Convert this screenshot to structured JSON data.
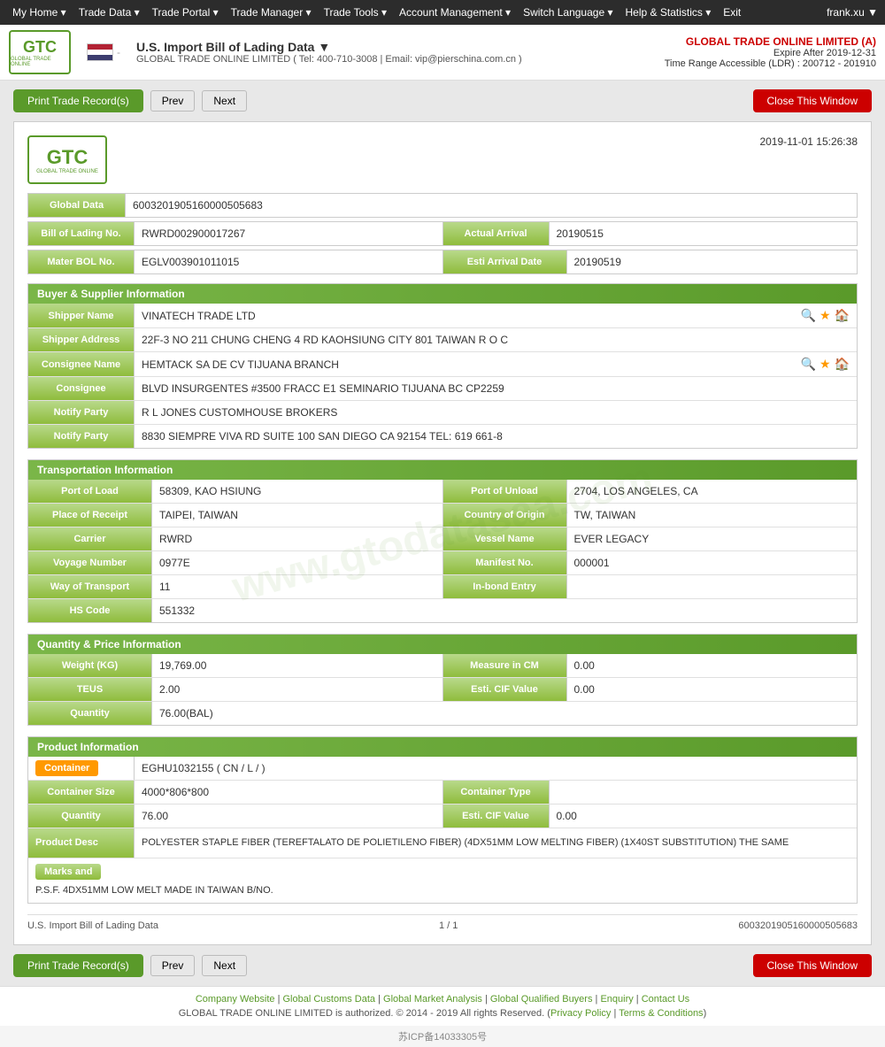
{
  "nav": {
    "items": [
      {
        "label": "My Home",
        "hasDropdown": true
      },
      {
        "label": "Trade Data",
        "hasDropdown": true
      },
      {
        "label": "Trade Portal",
        "hasDropdown": true
      },
      {
        "label": "Trade Manager",
        "hasDropdown": true
      },
      {
        "label": "Trade Tools",
        "hasDropdown": true
      },
      {
        "label": "Account Management",
        "hasDropdown": true
      },
      {
        "label": "Switch Language",
        "hasDropdown": true
      },
      {
        "label": "Help & Statistics",
        "hasDropdown": true
      },
      {
        "label": "Exit",
        "hasDropdown": false
      }
    ],
    "user": "frank.xu ▼"
  },
  "header": {
    "site_title": "U.S. Import Bill of Lading Data ▼",
    "contact": "GLOBAL TRADE ONLINE LIMITED ( Tel: 400-710-3008 | Email: vip@pierschina.com.cn )",
    "company": "GLOBAL TRADE ONLINE LIMITED (A)",
    "expire": "Expire After 2019-12-31",
    "time_range": "Time Range Accessible (LDR) : 200712 - 201910"
  },
  "toolbar": {
    "print_label": "Print Trade Record(s)",
    "prev_label": "Prev",
    "next_label": "Next",
    "close_label": "Close This Window"
  },
  "document": {
    "datetime": "2019-11-01 15:26:38",
    "global_data_label": "Global Data",
    "global_data_value": "6003201905160000505683",
    "bol_label": "Bill of Lading No.",
    "bol_value": "RWRD002900017267",
    "actual_arrival_label": "Actual Arrival",
    "actual_arrival_value": "20190515",
    "mater_bol_label": "Mater BOL No.",
    "mater_bol_value": "EGLV003901011015",
    "esti_arrival_label": "Esti Arrival Date",
    "esti_arrival_value": "20190519",
    "buyer_section": "Buyer & Supplier Information",
    "shipper_name_label": "Shipper Name",
    "shipper_name_value": "VINATECH TRADE LTD",
    "shipper_addr_label": "Shipper Address",
    "shipper_addr_value": "22F-3 NO 211 CHUNG CHENG 4 RD KAOHSIUNG CITY 801 TAIWAN R O C",
    "consignee_name_label": "Consignee Name",
    "consignee_name_value": "HEMTACK SA DE CV TIJUANA BRANCH",
    "consignee_label": "Consignee",
    "consignee_value": "BLVD INSURGENTES #3500 FRACC E1 SEMINARIO TIJUANA BC CP2259",
    "notify1_label": "Notify Party",
    "notify1_value": "R L JONES CUSTOMHOUSE BROKERS",
    "notify2_label": "Notify Party",
    "notify2_value": "8830 SIEMPRE VIVA RD SUITE 100 SAN DIEGO CA 92154 TEL: 619 661-8",
    "transport_section": "Transportation Information",
    "port_load_label": "Port of Load",
    "port_load_value": "58309, KAO HSIUNG",
    "port_unload_label": "Port of Unload",
    "port_unload_value": "2704, LOS ANGELES, CA",
    "place_receipt_label": "Place of Receipt",
    "place_receipt_value": "TAIPEI, TAIWAN",
    "country_origin_label": "Country of Origin",
    "country_origin_value": "TW, TAIWAN",
    "carrier_label": "Carrier",
    "carrier_value": "RWRD",
    "vessel_label": "Vessel Name",
    "vessel_value": "EVER LEGACY",
    "voyage_label": "Voyage Number",
    "voyage_value": "0977E",
    "manifest_label": "Manifest No.",
    "manifest_value": "000001",
    "transport_label": "Way of Transport",
    "transport_value": "11",
    "inbond_label": "In-bond Entry",
    "inbond_value": "",
    "hscode_label": "HS Code",
    "hscode_value": "551332",
    "qty_section": "Quantity & Price Information",
    "weight_label": "Weight (KG)",
    "weight_value": "19,769.00",
    "measure_label": "Measure in CM",
    "measure_value": "0.00",
    "teus_label": "TEUS",
    "teus_value": "2.00",
    "esti_cif_label": "Esti. CIF Value",
    "esti_cif_value": "0.00",
    "qty_label": "Quantity",
    "qty_value": "76.00(BAL)",
    "product_section": "Product Information",
    "container_label": "Container",
    "container_value": "EGHU1032155 ( CN / L / )",
    "container_size_label": "Container Size",
    "container_size_value": "4000*806*800",
    "container_type_label": "Container Type",
    "container_type_value": "",
    "qty2_label": "Quantity",
    "qty2_value": "76.00",
    "esti_cif2_label": "Esti. CIF Value",
    "esti_cif2_value": "0.00",
    "product_desc_label": "Product Desc",
    "product_desc_value": "POLYESTER STAPLE FIBER (TEREFTALATO DE POLIETILENO FIBER) (4DX51MM LOW MELTING FIBER) (1X40ST SUBSTITUTION) THE SAME",
    "marks_label": "Marks and",
    "marks_value": "P.S.F. 4DX51MM LOW MELT MADE IN TAIWAN B/NO.",
    "footer_left": "U.S. Import Bill of Lading Data",
    "footer_page": "1 / 1",
    "footer_id": "6003201905160000505683",
    "watermark": "www.gtodatasaa.com"
  },
  "site_footer": {
    "links": [
      "Company Website",
      "Global Customs Data",
      "Global Market Analysis",
      "Global Qualified Buyers",
      "Enquiry",
      "Contact Us"
    ],
    "copyright": "GLOBAL TRADE ONLINE LIMITED is authorized. © 2014 - 2019 All rights Reserved.",
    "policy_links": [
      "Privacy Policy",
      "Terms & Conditions"
    ],
    "icp": "苏ICP备14033305号"
  }
}
